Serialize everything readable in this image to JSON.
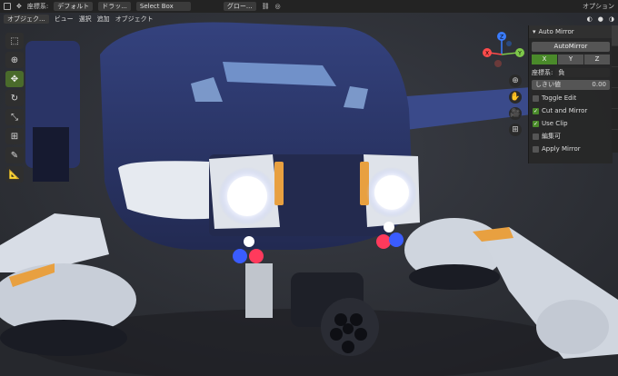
{
  "topbar": {
    "coord_label": "座標系:",
    "orientation": "デフォルト",
    "drag_label": "ドラッ...",
    "select_mode": "Select Box",
    "pivot": "グロー...",
    "options": "オプション"
  },
  "menubar": {
    "mode": "オブジェク...",
    "view": "ビュー",
    "select": "選択",
    "add": "追加",
    "object": "オブジェクト"
  },
  "gizmo": {
    "y_label": "Y",
    "z_label": "Z",
    "x_label": "X"
  },
  "panel": {
    "title": "Auto Mirror",
    "automirror_button": "AutoMirror",
    "axes": [
      "X",
      "Y",
      "Z"
    ],
    "orientation_label": "座標系:",
    "orientation_value": "負",
    "threshold_label": "しきい値",
    "threshold_value": "0.00",
    "toggle_edit": "Toggle Edit",
    "cut_and_mirror": "Cut and Mirror",
    "use_clip": "Use Clip",
    "editable": "編集可",
    "apply_mirror": "Apply Mirror"
  },
  "checkbox_states": {
    "toggle_edit": false,
    "cut_and_mirror": true,
    "use_clip": true,
    "editable": false,
    "apply_mirror": false
  },
  "colors": {
    "accent": "#4a8a2a",
    "robot_body": "#2f3c77",
    "robot_white": "#e8ecf0",
    "light": "#ffffff",
    "orange": "#e8a040"
  }
}
